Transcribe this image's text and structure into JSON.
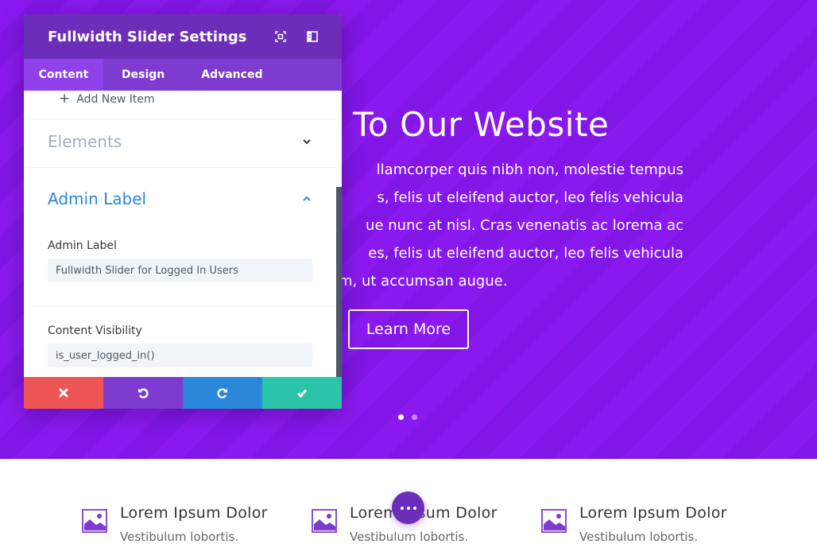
{
  "hero": {
    "title": "To Our Website",
    "body_lines": [
      "llamcorper quis nibh non, molestie tempus",
      "s, felis ut eleifend auctor, leo felis vehicula",
      "ue nunc at nisl. Cras venenatis ac lorema ac",
      "es, felis ut eleifend auctor, leo felis vehicula",
      "m, ut accumsan augue."
    ],
    "button_label": "Learn More",
    "slide_count": 2,
    "active_slide": 1,
    "colors": {
      "background": "#8a19ef",
      "stripe": "#8116e6"
    }
  },
  "modal": {
    "title": "Fullwidth Slider Settings",
    "header_icons": [
      "expand-icon",
      "sidebar-toggle-icon"
    ],
    "tabs": [
      {
        "label": "Content",
        "active": true
      },
      {
        "label": "Design",
        "active": false
      },
      {
        "label": "Advanced",
        "active": false
      }
    ],
    "add_item_label": "Add New Item",
    "sections": {
      "elements": {
        "title": "Elements",
        "expanded": false
      },
      "admin_label": {
        "title": "Admin Label",
        "expanded": true
      }
    },
    "fields": {
      "admin_label": {
        "label": "Admin Label",
        "value": "Fullwidth Slider for Logged In Users"
      },
      "content_visibility": {
        "label": "Content Visibility",
        "value": "is_user_logged_in()"
      }
    },
    "actions": [
      {
        "name": "discard",
        "icon": "close-icon",
        "color": "#ef5555"
      },
      {
        "name": "undo",
        "icon": "undo-icon",
        "color": "#7e3bd0"
      },
      {
        "name": "redo",
        "icon": "redo-icon",
        "color": "#2b87da"
      },
      {
        "name": "save",
        "icon": "check-icon",
        "color": "#29c4a9"
      }
    ],
    "colors": {
      "header": "#6c2eb9",
      "tabs": "#7e3bd0",
      "active_tab": "#8f42ec",
      "accent": "#2b87da"
    }
  },
  "blurbs": [
    {
      "title": "Lorem Ipsum Dolor",
      "text": "Vestibulum lobortis."
    },
    {
      "title": "Lorem Ipsum Dolor",
      "text": "Vestibulum lobortis."
    },
    {
      "title": "Lorem Ipsum Dolor",
      "text": "Vestibulum lobortis."
    }
  ],
  "fab": {
    "icon": "more-dots-icon",
    "color": "#6c2eb9"
  }
}
